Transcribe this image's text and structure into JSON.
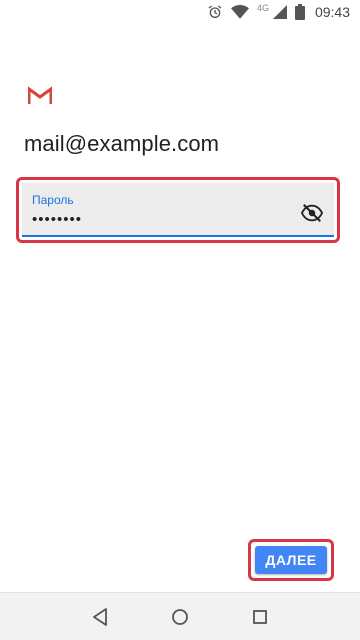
{
  "status_bar": {
    "time": "09:43",
    "network": "4G",
    "icons": [
      "alarm-icon",
      "wifi-icon",
      "signal-icon",
      "battery-icon"
    ]
  },
  "app": {
    "logo": "gmail-logo",
    "brand_color": "#d44638"
  },
  "account": {
    "email": "mail@example.com"
  },
  "password_field": {
    "label": "Пароль",
    "value": "••••••••",
    "visibility_icon": "eye-off-icon",
    "accent_color": "#1a73e8"
  },
  "next_button": {
    "label": "ДАЛЕЕ",
    "color": "#4285f4"
  },
  "highlight_color": "#d93645",
  "nav_bar": {
    "buttons": [
      "back-icon",
      "home-icon",
      "recents-icon"
    ]
  }
}
